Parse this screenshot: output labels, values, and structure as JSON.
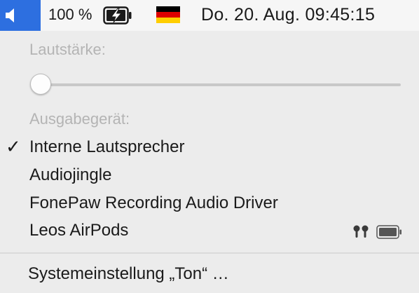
{
  "menubar": {
    "volume_icon": "speaker-icon",
    "battery_percent": "100 %",
    "battery_icon": "battery-charging-icon",
    "input_source_icon": "german-flag-icon",
    "clock": "Do. 20. Aug.  09:45:15",
    "highlight_color": "#2d6fe0"
  },
  "volume_menu": {
    "volume_label": "Lautstärke:",
    "volume_level": 0,
    "output_label": "Ausgabegerät:",
    "devices": [
      {
        "label": "Interne Lautsprecher",
        "selected": true
      },
      {
        "label": "Audiojingle",
        "selected": false
      },
      {
        "label": "FonePaw Recording Audio Driver",
        "selected": false
      },
      {
        "label": "Leos AirPods",
        "selected": false,
        "icons": [
          "airpods-icon",
          "battery-icon"
        ]
      }
    ],
    "checkmark": "✓",
    "settings_item": "Systemeinstellung „Ton“ …"
  }
}
